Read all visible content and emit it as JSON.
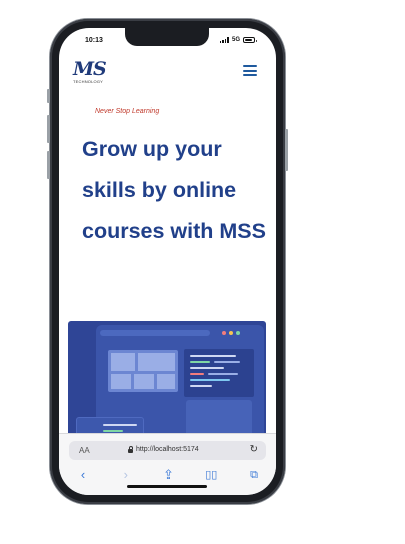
{
  "status_bar": {
    "time": "10:13",
    "network": "5G"
  },
  "header": {
    "logo_mark": "MS",
    "logo_sub": "TECHNOLOGY",
    "menu_icon": "hamburger-menu-icon"
  },
  "hero": {
    "tagline": "Never Stop Learning",
    "headline": "Grow up your skills by online courses with MSS"
  },
  "illustration": {
    "badge_icon": "expand-icon",
    "colors": {
      "background": "#2f4596",
      "badge": "#f6c453"
    }
  },
  "browser": {
    "text_size_label": "AA",
    "url": "http://localhost:5174",
    "toolbar": {
      "back_icon": "chevron-left-icon",
      "forward_icon": "chevron-right-icon",
      "share_icon": "share-icon",
      "bookmarks_icon": "book-icon",
      "tabs_icon": "tabs-icon"
    }
  },
  "colors": {
    "headline": "#21408a",
    "tagline": "#c0392b",
    "accent": "#3a78d6"
  }
}
